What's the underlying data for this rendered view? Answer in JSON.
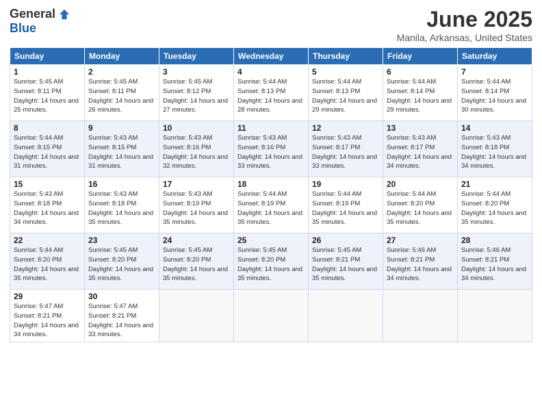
{
  "logo": {
    "general": "General",
    "blue": "Blue"
  },
  "title": "June 2025",
  "location": "Manila, Arkansas, United States",
  "weekdays": [
    "Sunday",
    "Monday",
    "Tuesday",
    "Wednesday",
    "Thursday",
    "Friday",
    "Saturday"
  ],
  "weeks": [
    [
      {
        "day": "1",
        "sunrise": "5:45 AM",
        "sunset": "8:11 PM",
        "daylight": "14 hours and 25 minutes."
      },
      {
        "day": "2",
        "sunrise": "5:45 AM",
        "sunset": "8:11 PM",
        "daylight": "14 hours and 26 minutes."
      },
      {
        "day": "3",
        "sunrise": "5:45 AM",
        "sunset": "8:12 PM",
        "daylight": "14 hours and 27 minutes."
      },
      {
        "day": "4",
        "sunrise": "5:44 AM",
        "sunset": "8:13 PM",
        "daylight": "14 hours and 28 minutes."
      },
      {
        "day": "5",
        "sunrise": "5:44 AM",
        "sunset": "8:13 PM",
        "daylight": "14 hours and 29 minutes."
      },
      {
        "day": "6",
        "sunrise": "5:44 AM",
        "sunset": "8:14 PM",
        "daylight": "14 hours and 29 minutes."
      },
      {
        "day": "7",
        "sunrise": "5:44 AM",
        "sunset": "8:14 PM",
        "daylight": "14 hours and 30 minutes."
      }
    ],
    [
      {
        "day": "8",
        "sunrise": "5:44 AM",
        "sunset": "8:15 PM",
        "daylight": "14 hours and 31 minutes."
      },
      {
        "day": "9",
        "sunrise": "5:43 AM",
        "sunset": "8:15 PM",
        "daylight": "14 hours and 31 minutes."
      },
      {
        "day": "10",
        "sunrise": "5:43 AM",
        "sunset": "8:16 PM",
        "daylight": "14 hours and 32 minutes."
      },
      {
        "day": "11",
        "sunrise": "5:43 AM",
        "sunset": "8:16 PM",
        "daylight": "14 hours and 33 minutes."
      },
      {
        "day": "12",
        "sunrise": "5:43 AM",
        "sunset": "8:17 PM",
        "daylight": "14 hours and 33 minutes."
      },
      {
        "day": "13",
        "sunrise": "5:43 AM",
        "sunset": "8:17 PM",
        "daylight": "14 hours and 34 minutes."
      },
      {
        "day": "14",
        "sunrise": "5:43 AM",
        "sunset": "8:18 PM",
        "daylight": "14 hours and 34 minutes."
      }
    ],
    [
      {
        "day": "15",
        "sunrise": "5:43 AM",
        "sunset": "8:18 PM",
        "daylight": "14 hours and 34 minutes."
      },
      {
        "day": "16",
        "sunrise": "5:43 AM",
        "sunset": "8:18 PM",
        "daylight": "14 hours and 35 minutes."
      },
      {
        "day": "17",
        "sunrise": "5:43 AM",
        "sunset": "8:19 PM",
        "daylight": "14 hours and 35 minutes."
      },
      {
        "day": "18",
        "sunrise": "5:44 AM",
        "sunset": "8:19 PM",
        "daylight": "14 hours and 35 minutes."
      },
      {
        "day": "19",
        "sunrise": "5:44 AM",
        "sunset": "8:19 PM",
        "daylight": "14 hours and 35 minutes."
      },
      {
        "day": "20",
        "sunrise": "5:44 AM",
        "sunset": "8:20 PM",
        "daylight": "14 hours and 35 minutes."
      },
      {
        "day": "21",
        "sunrise": "5:44 AM",
        "sunset": "8:20 PM",
        "daylight": "14 hours and 35 minutes."
      }
    ],
    [
      {
        "day": "22",
        "sunrise": "5:44 AM",
        "sunset": "8:20 PM",
        "daylight": "14 hours and 35 minutes."
      },
      {
        "day": "23",
        "sunrise": "5:45 AM",
        "sunset": "8:20 PM",
        "daylight": "14 hours and 35 minutes."
      },
      {
        "day": "24",
        "sunrise": "5:45 AM",
        "sunset": "8:20 PM",
        "daylight": "14 hours and 35 minutes."
      },
      {
        "day": "25",
        "sunrise": "5:45 AM",
        "sunset": "8:20 PM",
        "daylight": "14 hours and 35 minutes."
      },
      {
        "day": "26",
        "sunrise": "5:45 AM",
        "sunset": "8:21 PM",
        "daylight": "14 hours and 35 minutes."
      },
      {
        "day": "27",
        "sunrise": "5:46 AM",
        "sunset": "8:21 PM",
        "daylight": "14 hours and 34 minutes."
      },
      {
        "day": "28",
        "sunrise": "5:46 AM",
        "sunset": "8:21 PM",
        "daylight": "14 hours and 34 minutes."
      }
    ],
    [
      {
        "day": "29",
        "sunrise": "5:47 AM",
        "sunset": "8:21 PM",
        "daylight": "14 hours and 34 minutes."
      },
      {
        "day": "30",
        "sunrise": "5:47 AM",
        "sunset": "8:21 PM",
        "daylight": "14 hours and 33 minutes."
      },
      null,
      null,
      null,
      null,
      null
    ]
  ]
}
